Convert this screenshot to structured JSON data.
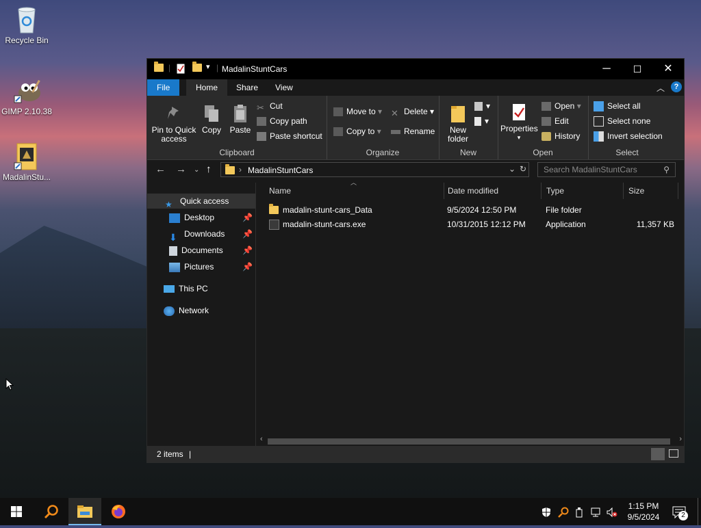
{
  "desktop": {
    "icons": [
      {
        "label": "Recycle Bin",
        "icon": "recycle-bin-icon"
      },
      {
        "label": "GIMP 2.10.38",
        "icon": "gimp-icon"
      },
      {
        "label": "MadalinStu...",
        "icon": "game-shortcut-icon"
      }
    ]
  },
  "window": {
    "title": "MadalinStuntCars",
    "controls": {
      "minimize": "─",
      "maximize": "☐",
      "close": "✕"
    }
  },
  "ribbon": {
    "tabs": [
      "File",
      "Home",
      "Share",
      "View"
    ],
    "clipboard": {
      "label": "Clipboard",
      "pin": "Pin to Quick access",
      "copy": "Copy",
      "paste": "Paste",
      "cut": "Cut",
      "copy_path": "Copy path",
      "paste_shortcut": "Paste shortcut"
    },
    "organize": {
      "label": "Organize",
      "move_to": "Move to",
      "copy_to": "Copy to",
      "delete": "Delete",
      "rename": "Rename"
    },
    "new": {
      "label": "New",
      "new_folder": "New folder"
    },
    "open": {
      "label": "Open",
      "properties": "Properties",
      "open": "Open",
      "edit": "Edit",
      "history": "History"
    },
    "select": {
      "label": "Select",
      "select_all": "Select all",
      "select_none": "Select none",
      "invert": "Invert selection"
    }
  },
  "address": {
    "path": "MadalinStuntCars",
    "search_placeholder": "Search MadalinStuntCars"
  },
  "navpane": {
    "quick_access": "Quick access",
    "items": [
      "Desktop",
      "Downloads",
      "Documents",
      "Pictures"
    ],
    "this_pc": "This PC",
    "network": "Network"
  },
  "files": {
    "columns": [
      "Name",
      "Date modified",
      "Type",
      "Size"
    ],
    "rows": [
      {
        "name": "madalin-stunt-cars_Data",
        "date": "9/5/2024 12:50 PM",
        "type": "File folder",
        "size": ""
      },
      {
        "name": "madalin-stunt-cars.exe",
        "date": "10/31/2015 12:12 PM",
        "type": "Application",
        "size": "11,357 KB"
      }
    ]
  },
  "status": {
    "count": "2 items"
  },
  "taskbar": {
    "time": "1:15 PM",
    "date": "9/5/2024",
    "notifications": "2"
  },
  "colors": {
    "accent": "#1979ca",
    "folder": "#f3c85a",
    "window_bg": "#191919",
    "ribbon_bg": "#2b2b2b"
  }
}
